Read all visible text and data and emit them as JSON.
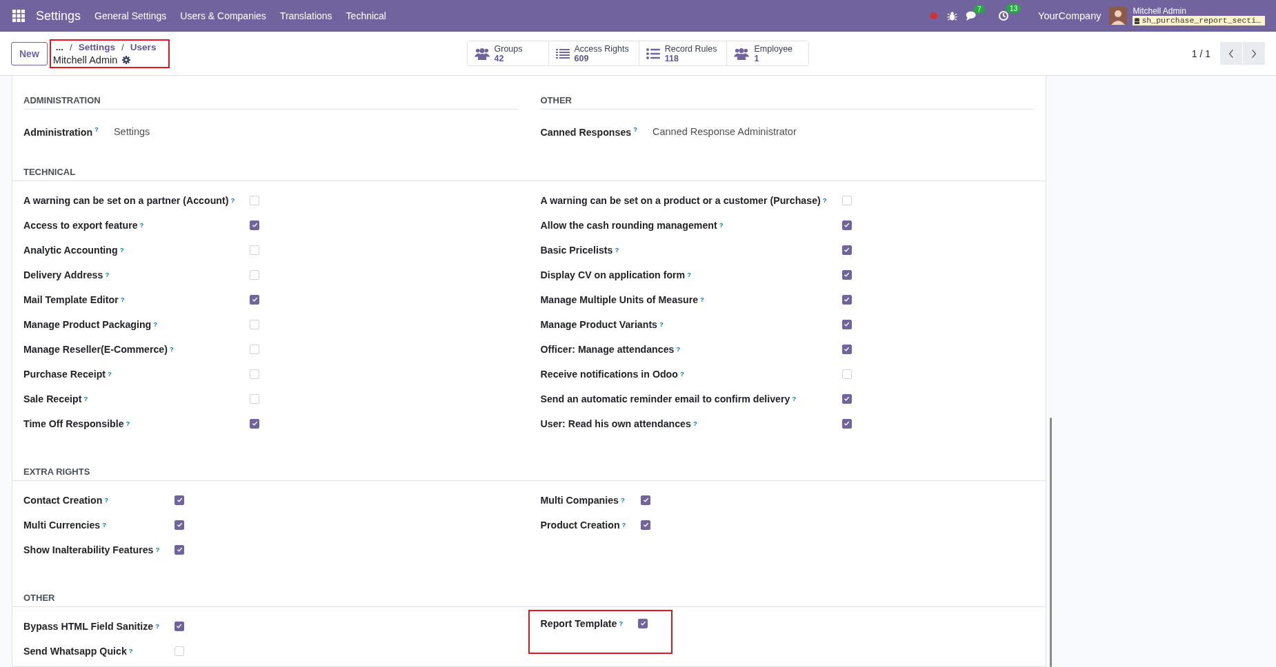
{
  "navbar": {
    "app_title": "Settings",
    "menu": [
      "General Settings",
      "Users & Companies",
      "Translations",
      "Technical"
    ],
    "chat_badge": "7",
    "activity_badge": "13",
    "company": "YourCompany",
    "user_name": "Mitchell Admin",
    "database": "sh_purchase_report_secti…"
  },
  "control_panel": {
    "new_button": "New",
    "breadcrumb": {
      "highlighted": true,
      "more": "...",
      "items": [
        "Settings",
        "Users"
      ],
      "separator": "/",
      "record_title": "Mitchell Admin"
    },
    "smart_buttons": [
      {
        "kind": "people",
        "label": "Groups",
        "value": "42"
      },
      {
        "kind": "list",
        "label": "Access Rights",
        "value": "609"
      },
      {
        "kind": "bullets",
        "label": "Record Rules",
        "value": "118"
      },
      {
        "kind": "people",
        "label": "Employee",
        "value": "1"
      }
    ],
    "pager": "1 / 1"
  },
  "groups": [
    {
      "kind": "selections",
      "columns": [
        {
          "title": "ADMINISTRATION",
          "fields": [
            {
              "label": "Administration",
              "help": "?",
              "value": "Settings"
            }
          ]
        },
        {
          "title": "OTHER",
          "fields": [
            {
              "label": "Canned Responses",
              "help": "?",
              "value": "Canned Response Administrator"
            }
          ]
        }
      ]
    },
    {
      "kind": "checkboxes",
      "title": "TECHNICAL",
      "columns": [
        [
          {
            "label": "A warning can be set on a partner (Account)",
            "help": "?",
            "checked": false,
            "highlighted": false
          },
          {
            "label": "Access to export feature",
            "help": "?",
            "checked": true,
            "highlighted": false
          },
          {
            "label": "Analytic Accounting",
            "help": "?",
            "checked": false,
            "highlighted": false
          },
          {
            "label": "Delivery Address",
            "help": "?",
            "checked": false,
            "highlighted": false
          },
          {
            "label": "Mail Template Editor",
            "help": "?",
            "checked": true,
            "highlighted": false
          },
          {
            "label": "Manage Product Packaging",
            "help": "?",
            "checked": false,
            "highlighted": false
          },
          {
            "label": "Manage Reseller(E-Commerce)",
            "help": "?",
            "checked": false,
            "highlighted": false
          },
          {
            "label": "Purchase Receipt",
            "help": "?",
            "checked": false,
            "highlighted": false
          },
          {
            "label": "Sale Receipt",
            "help": "?",
            "checked": false,
            "highlighted": false
          },
          {
            "label": "Time Off Responsible",
            "help": "?",
            "checked": true,
            "highlighted": false
          }
        ],
        [
          {
            "label": "A warning can be set on a product or a customer (Purchase)",
            "help": "?",
            "checked": false,
            "highlighted": false
          },
          {
            "label": "Allow the cash rounding management",
            "help": "?",
            "checked": true,
            "highlighted": false
          },
          {
            "label": "Basic Pricelists",
            "help": "?",
            "checked": true,
            "highlighted": false
          },
          {
            "label": "Display CV on application form",
            "help": "?",
            "checked": true,
            "highlighted": false
          },
          {
            "label": "Manage Multiple Units of Measure",
            "help": "?",
            "checked": true,
            "highlighted": false
          },
          {
            "label": "Manage Product Variants",
            "help": "?",
            "checked": true,
            "highlighted": false
          },
          {
            "label": "Officer: Manage attendances",
            "help": "?",
            "checked": true,
            "highlighted": false
          },
          {
            "label": "Receive notifications in Odoo",
            "help": "?",
            "checked": false,
            "highlighted": false
          },
          {
            "label": "Send an automatic reminder email to confirm delivery",
            "help": "?",
            "checked": true,
            "highlighted": false
          },
          {
            "label": "User: Read his own attendances",
            "help": "?",
            "checked": true,
            "highlighted": false
          }
        ]
      ]
    },
    {
      "kind": "checkboxes",
      "title": "EXTRA RIGHTS",
      "columns": [
        [
          {
            "label": "Contact Creation",
            "help": "?",
            "checked": true,
            "highlighted": false
          },
          {
            "label": "Multi Currencies",
            "help": "?",
            "checked": true,
            "highlighted": false
          },
          {
            "label": "Show Inalterability Features",
            "help": "?",
            "checked": true,
            "highlighted": false
          }
        ],
        [
          {
            "label": "Multi Companies",
            "help": "?",
            "checked": true,
            "highlighted": false
          },
          {
            "label": "Product Creation",
            "help": "?",
            "checked": true,
            "highlighted": false
          }
        ]
      ]
    },
    {
      "kind": "checkboxes",
      "title": "OTHER",
      "columns": [
        [
          {
            "label": "Bypass HTML Field Sanitize",
            "help": "?",
            "checked": true,
            "highlighted": false
          },
          {
            "label": "Send Whatsapp Quick",
            "help": "?",
            "checked": false,
            "highlighted": false
          }
        ],
        [
          {
            "label": "Report Template",
            "help": "?",
            "checked": true,
            "highlighted": true
          }
        ]
      ]
    }
  ]
}
